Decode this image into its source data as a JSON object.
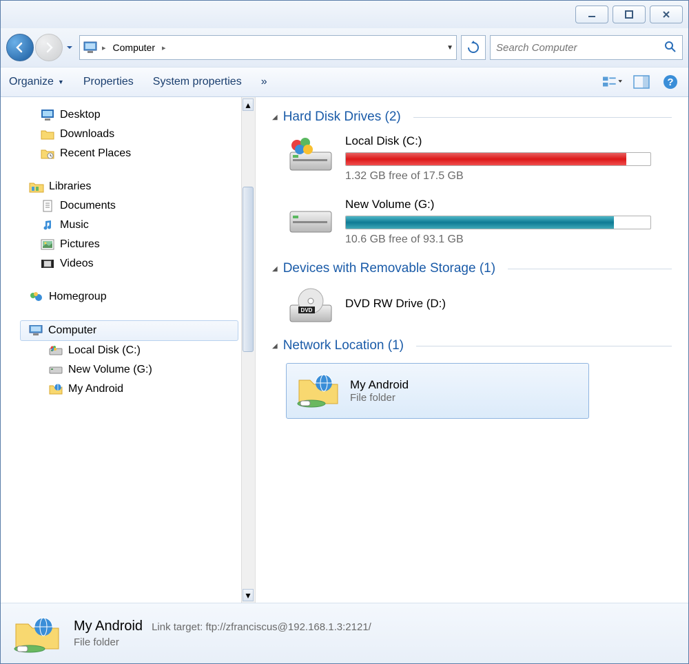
{
  "titlebar": {
    "min": "–",
    "max": "▢",
    "close": "✕"
  },
  "breadcrumb": {
    "root": "Computer"
  },
  "search": {
    "placeholder": "Search Computer"
  },
  "toolbar": {
    "organize": "Organize",
    "properties": "Properties",
    "sysprops": "System properties",
    "more": "»"
  },
  "tree": {
    "desktop": "Desktop",
    "downloads": "Downloads",
    "recent": "Recent Places",
    "libraries": "Libraries",
    "documents": "Documents",
    "music": "Music",
    "pictures": "Pictures",
    "videos": "Videos",
    "homegroup": "Homegroup",
    "computer": "Computer",
    "localc": "Local Disk (C:)",
    "newvol": "New Volume (G:)",
    "myandroid": "My Android"
  },
  "sections": {
    "hdd": "Hard Disk Drives (2)",
    "removable": "Devices with Removable Storage (1)",
    "network": "Network Location (1)"
  },
  "drives": {
    "c": {
      "name": "Local Disk (C:)",
      "stat": "1.32 GB free of 17.5 GB"
    },
    "g": {
      "name": "New Volume (G:)",
      "stat": "10.6 GB free of 93.1 GB"
    }
  },
  "dvd": {
    "name": "DVD RW Drive (D:)"
  },
  "netloc": {
    "name": "My Android",
    "type": "File folder"
  },
  "details": {
    "name": "My Android",
    "target_label": "Link target:",
    "target": "ftp://zfranciscus@192.168.1.3:2121/",
    "type": "File folder"
  }
}
